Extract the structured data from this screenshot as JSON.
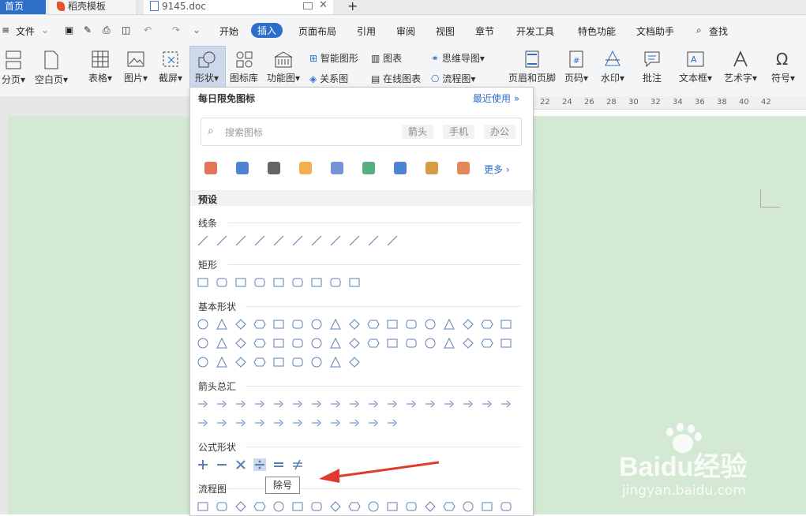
{
  "tabs": {
    "home": "首页",
    "daoke": "稻壳模板",
    "doc": "9145.doc",
    "add": "+"
  },
  "menu": {
    "file": "文件",
    "items": [
      "开始",
      "插入",
      "页面布局",
      "引用",
      "审阅",
      "视图",
      "章节",
      "开发工具",
      "特色功能",
      "文档助手"
    ],
    "search": "查找"
  },
  "ribbon": {
    "large": [
      "分页",
      "空白页",
      "表格",
      "图片",
      "截屏",
      "形状",
      "图标库",
      "功能图"
    ],
    "small": [
      "智能图形",
      "图表",
      "关系图",
      "在线图表",
      "思维导图",
      "流程图"
    ],
    "right": [
      "页眉和页脚",
      "页码",
      "水印",
      "批注",
      "文本框",
      "艺术字",
      "符号"
    ]
  },
  "ruler": [
    "22",
    "24",
    "26",
    "28",
    "30",
    "32",
    "34",
    "36",
    "38",
    "40",
    "42"
  ],
  "panel": {
    "title": "每日限免图标",
    "recent": "最近使用",
    "search_placeholder": "搜索图标",
    "chips": [
      "箭头",
      "手机",
      "办公"
    ],
    "more": "更多",
    "preset": "预设",
    "sections": [
      "线条",
      "矩形",
      "基本形状",
      "箭头总汇",
      "公式形状",
      "流程图"
    ]
  },
  "tooltip": "除号",
  "watermark": {
    "brand": "Baidu经验",
    "url": "jingyan.baidu.com"
  },
  "colors": {
    "accent": "#2d6ec9",
    "doc_bg": "#d4e9d4",
    "arrow": "#e03a2f",
    "shape_stroke": "#5b7fb5"
  }
}
